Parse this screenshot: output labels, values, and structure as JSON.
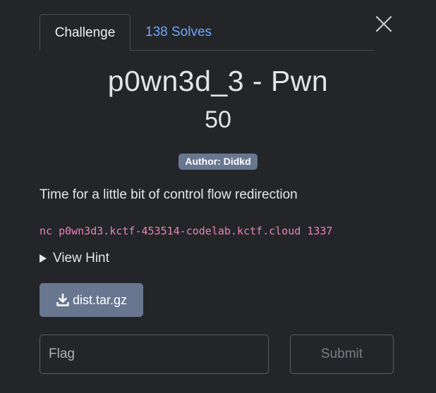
{
  "tabs": {
    "challenge_label": "Challenge",
    "solves_label": "138 Solves"
  },
  "challenge": {
    "title": "p0wn3d_3 - Pwn",
    "points": "50",
    "author": "Author: Didkd",
    "description": "Time for a little bit of control flow redirection",
    "connection": "nc p0wn3d3.kctf-453514-codelab.kctf.cloud 1337",
    "hint_label": "View Hint",
    "file_label": "dist.tar.gz"
  },
  "form": {
    "flag_placeholder": "Flag",
    "flag_value": "",
    "submit_label": "Submit"
  },
  "icons": {
    "close": "close-icon",
    "download": "download-icon",
    "hint": "caret-right-icon"
  },
  "colors": {
    "background": "#232529",
    "link": "#6ea8fe",
    "badge": "#68778f",
    "code": "#e685b5"
  }
}
